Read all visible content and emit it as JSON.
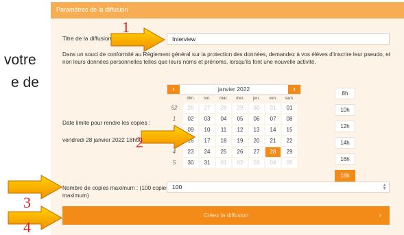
{
  "background_text": [
    "votre",
    "e de"
  ],
  "panel": {
    "header": "Paramètres de la diffusion",
    "title_label": "Titre de la diffusion",
    "title_value": "Interview",
    "notice": "Dans un souci de conformité au Règlement général sur la protection des données, demandez à vos élèves d'inscrire leur pseudo, et non leurs données personnelles telles que leurs noms et prénoms, lorsqu'ils font une nouvelle activité.",
    "deadline_label": "Date limite pour rendre les copies :",
    "deadline_value": "vendredi 28 janvier 2022 18h00",
    "copies_label": "Nombre de copies maximum : (100 copies maximum)",
    "copies_value": "100",
    "create_button": "Créez la diffusion",
    "create_chevron": "›"
  },
  "calendar": {
    "prev": "‹",
    "next": "›",
    "month_title": "janvier 2022",
    "weekdays": [
      "dim.",
      "lun.",
      "mar.",
      "mer.",
      "jeu.",
      "ven.",
      "sam."
    ],
    "weeks": [
      {
        "week": "52",
        "days": [
          {
            "d": "26",
            "muted": true
          },
          {
            "d": "27",
            "muted": true
          },
          {
            "d": "28",
            "muted": true
          },
          {
            "d": "29",
            "muted": true
          },
          {
            "d": "30",
            "muted": true
          },
          {
            "d": "31",
            "muted": true
          },
          {
            "d": "01"
          }
        ]
      },
      {
        "week": "1",
        "days": [
          {
            "d": "02"
          },
          {
            "d": "03"
          },
          {
            "d": "04"
          },
          {
            "d": "05"
          },
          {
            "d": "06"
          },
          {
            "d": "07"
          },
          {
            "d": "08"
          }
        ]
      },
      {
        "week": "2",
        "days": [
          {
            "d": "09"
          },
          {
            "d": "10"
          },
          {
            "d": "11"
          },
          {
            "d": "12"
          },
          {
            "d": "13"
          },
          {
            "d": "14"
          },
          {
            "d": "15"
          }
        ]
      },
      {
        "week": "3",
        "days": [
          {
            "d": "16"
          },
          {
            "d": "17"
          },
          {
            "d": "18"
          },
          {
            "d": "19"
          },
          {
            "d": "20"
          },
          {
            "d": "21"
          },
          {
            "d": "22"
          }
        ]
      },
      {
        "week": "4",
        "days": [
          {
            "d": "23"
          },
          {
            "d": "24"
          },
          {
            "d": "25"
          },
          {
            "d": "26"
          },
          {
            "d": "27"
          },
          {
            "d": "28",
            "selected": true
          },
          {
            "d": "29"
          }
        ]
      },
      {
        "week": "5",
        "days": [
          {
            "d": "30"
          },
          {
            "d": "31"
          },
          {
            "d": "01",
            "muted": true
          },
          {
            "d": "02",
            "muted": true
          },
          {
            "d": "03",
            "muted": true
          },
          {
            "d": "04",
            "muted": true
          },
          {
            "d": "05",
            "muted": true
          }
        ]
      }
    ]
  },
  "hours": [
    {
      "label": "8h"
    },
    {
      "label": "10h"
    },
    {
      "label": "12h"
    },
    {
      "label": "14h"
    },
    {
      "label": "16h"
    },
    {
      "label": "18h",
      "selected": true
    }
  ],
  "annotations": [
    "1",
    "2",
    "3",
    "4"
  ],
  "colors": {
    "accent": "#f28b17",
    "header": "#f7ad53",
    "panel_bg": "#fdf3e6",
    "annotation": "#d4261f"
  }
}
